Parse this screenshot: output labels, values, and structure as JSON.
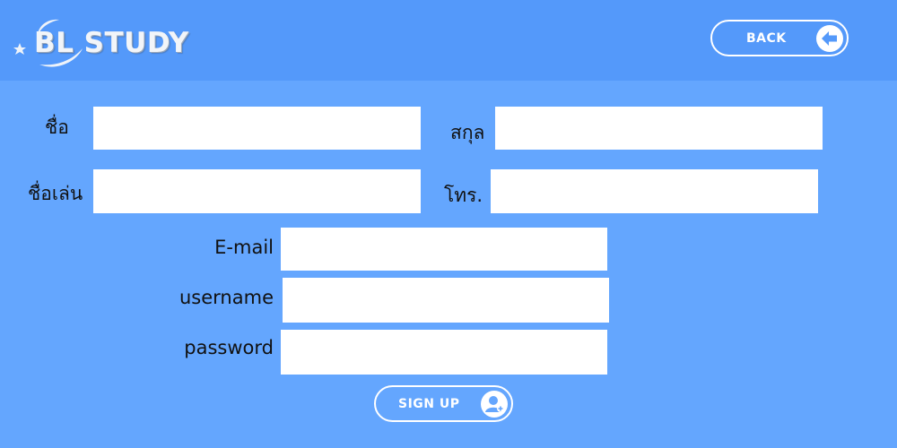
{
  "header": {
    "logo_text": "BL STUDY",
    "back_label": "BACK"
  },
  "form": {
    "first_name_label": "ชื่อ",
    "last_name_label": "สกุล",
    "nickname_label": "ชื่อเล่น",
    "phone_label": "โทร.",
    "email_label": "E-mail",
    "username_label": "username",
    "password_label": "password",
    "first_name_value": "",
    "last_name_value": "",
    "nickname_value": "",
    "phone_value": "",
    "email_value": "",
    "username_value": "",
    "password_value": ""
  },
  "signup": {
    "label": "SIGN UP"
  },
  "colors": {
    "background": "#64a6fe",
    "header": "#5499fa",
    "input": "#ffffff",
    "button_border": "#ffffff"
  }
}
